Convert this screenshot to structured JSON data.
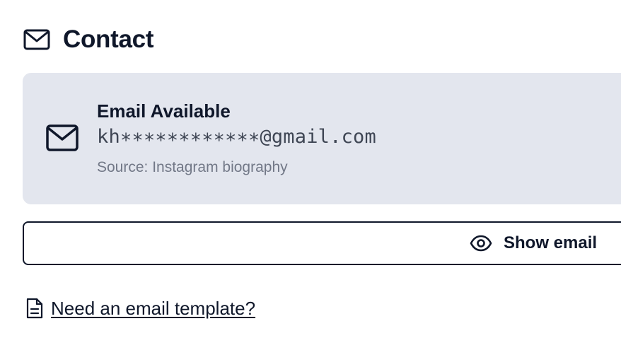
{
  "section": {
    "title": "Contact",
    "icon": "mail-icon"
  },
  "email_card": {
    "icon": "mail-icon",
    "title": "Email Available",
    "masked_email": "kh∗∗∗∗∗∗∗∗∗∗∗∗@gmail.com",
    "source": "Source: Instagram biography",
    "background": "#e3e6ee"
  },
  "show_email_button": {
    "label": "Show email",
    "icon": "eye-icon"
  },
  "template_link": {
    "label": "Need an email template?",
    "icon": "document-icon"
  }
}
